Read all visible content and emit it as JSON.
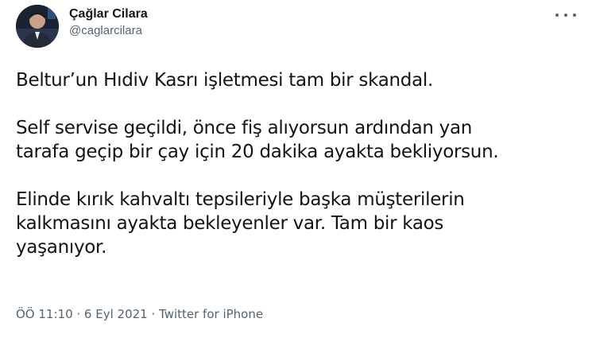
{
  "author": {
    "display_name": "Çağlar Cilara",
    "handle": "@caglarcilara"
  },
  "more_menu": {
    "icon": "more-horizontal-icon"
  },
  "tweet": {
    "paragraphs": [
      "Beltur’un Hıdiv Kasrı işletmesi tam bir skandal.",
      "Self servise geçildi, önce fiş alıyorsun ardından yan\ntarafa geçip bir çay için 20 dakika ayakta bekliyorsun.",
      "Elinde kırık kahvaltı tepsileriyle başka müşterilerin\nkalkmasını ayakta bekleyenler var. Tam bir kaos\nyaşanıyor."
    ]
  },
  "meta": {
    "time": "ÖÖ 11:10",
    "separator": " · ",
    "date": "6 Eyl 2021",
    "source": "Twitter for iPhone"
  }
}
